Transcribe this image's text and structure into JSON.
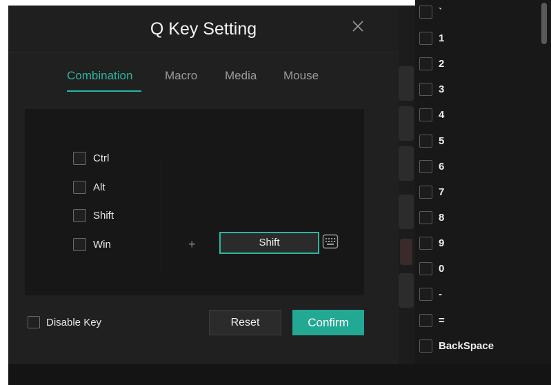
{
  "dialog": {
    "title": "Q Key Setting",
    "tabs": [
      {
        "label": "Combination",
        "active": true
      },
      {
        "label": "Macro",
        "active": false
      },
      {
        "label": "Media",
        "active": false
      },
      {
        "label": "Mouse",
        "active": false
      }
    ],
    "modifiers": [
      {
        "label": "Ctrl",
        "checked": false
      },
      {
        "label": "Alt",
        "checked": false
      },
      {
        "label": "Shift",
        "checked": false
      },
      {
        "label": "Win",
        "checked": false
      }
    ],
    "plus": "+",
    "key_value": "Shift",
    "disable_key_label": "Disable Key",
    "reset_label": "Reset",
    "confirm_label": "Confirm"
  },
  "key_list": {
    "items": [
      "`",
      "1",
      "2",
      "3",
      "4",
      "5",
      "6",
      "7",
      "8",
      "9",
      "0",
      "-",
      "=",
      "BackSpace"
    ]
  },
  "colors": {
    "accent": "#29b7a0",
    "confirm": "#23a893",
    "background": "#1c1c1c"
  },
  "icons": {
    "close": "close-icon",
    "keyboard": "keyboard-icon"
  }
}
